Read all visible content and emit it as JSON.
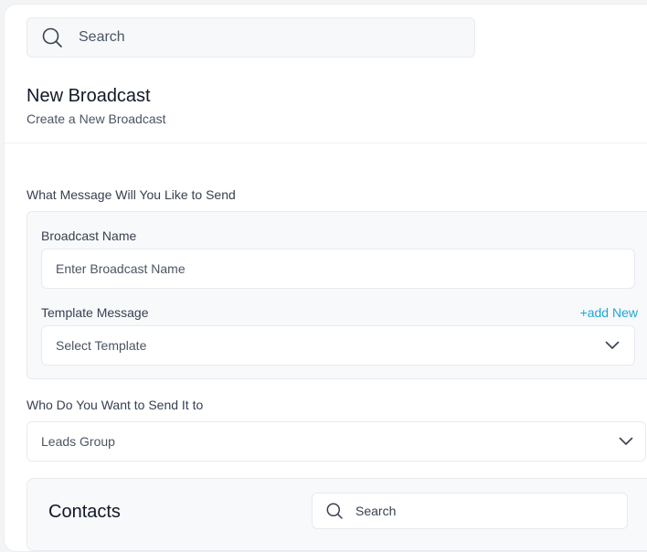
{
  "search": {
    "placeholder": "Search"
  },
  "header": {
    "title": "New Broadcast",
    "subtitle": "Create a New Broadcast"
  },
  "message_section": {
    "label": "What Message Will You Like to Send",
    "broadcast_name": {
      "label": "Broadcast Name",
      "placeholder": "Enter Broadcast Name"
    },
    "template": {
      "label": "Template Message",
      "add_link": "+add New",
      "selected": "Select Template"
    }
  },
  "recipient_section": {
    "label": "Who Do You Want to Send It to",
    "selected": "Leads Group"
  },
  "contacts": {
    "title": "Contacts",
    "search_placeholder": "Search"
  },
  "colors": {
    "accent": "#1ea7d9",
    "card_bg": "#f8f9fb",
    "border": "#e8eaee"
  }
}
